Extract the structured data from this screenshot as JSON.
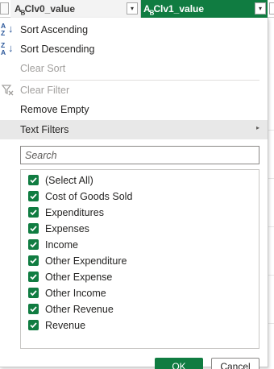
{
  "columns": [
    {
      "type_icon": "ABC",
      "name": "lv0_value",
      "dropdown_icon": "▾"
    },
    {
      "type_icon": "ABC",
      "name": "lv1_value",
      "dropdown_icon": "▾"
    }
  ],
  "menu": {
    "sort_ascending": "Sort Ascending",
    "sort_descending": "Sort Descending",
    "clear_sort": "Clear Sort",
    "clear_filter": "Clear Filter",
    "remove_empty": "Remove Empty",
    "text_filters": "Text Filters",
    "submenu_arrow": "▸"
  },
  "search": {
    "placeholder": "Search",
    "value": ""
  },
  "values_list": [
    {
      "label": "(Select All)",
      "checked": true
    },
    {
      "label": "Cost of Goods Sold",
      "checked": true
    },
    {
      "label": "Expenditures",
      "checked": true
    },
    {
      "label": "Expenses",
      "checked": true
    },
    {
      "label": "Income",
      "checked": true
    },
    {
      "label": "Other Expenditure",
      "checked": true
    },
    {
      "label": "Other Expense",
      "checked": true
    },
    {
      "label": "Other Income",
      "checked": true
    },
    {
      "label": "Other Revenue",
      "checked": true
    },
    {
      "label": "Revenue",
      "checked": true
    }
  ],
  "buttons": {
    "ok": "OK",
    "cancel": "Cancel"
  },
  "colors": {
    "accent": "#107c41",
    "disabled_text": "#a19f9d",
    "sort_icon": "#2b579a"
  }
}
